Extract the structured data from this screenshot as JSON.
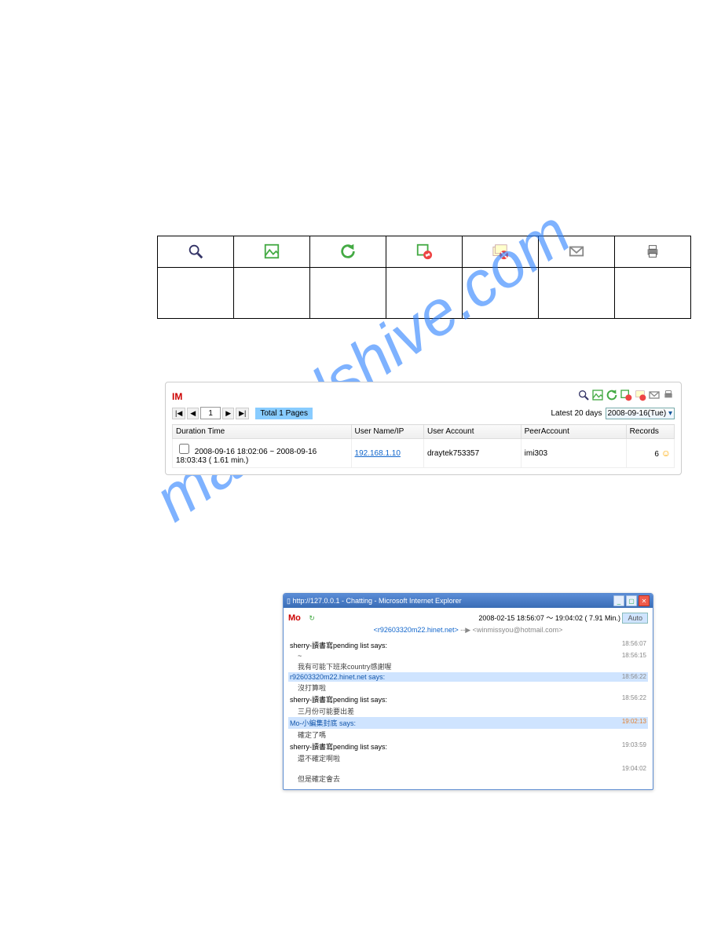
{
  "watermark": "manualshive.com",
  "toolbar_icons": {
    "search": "search-icon",
    "image": "image-icon",
    "refresh": "refresh-icon",
    "delsel": "delete-selected-icon",
    "delall": "delete-all-icon",
    "mail": "mail-icon",
    "print": "print-icon"
  },
  "toolbar_labels": {
    "search": "",
    "image": "",
    "refresh": "",
    "delsel": "",
    "delall": "",
    "mail": "",
    "print": ""
  },
  "im": {
    "title": "IM",
    "pager": {
      "first": "|◀",
      "prev": "◀",
      "page": "1",
      "next": "▶",
      "last": "▶|",
      "total": "Total 1 Pages"
    },
    "latest_label": "Latest 20 days",
    "latest_value": "2008-09-16(Tue)",
    "columns": {
      "duration": "Duration Time",
      "username": "User Name/IP",
      "useraccount": "User Account",
      "peeraccount": "PeerAccount",
      "records": "Records"
    },
    "row": {
      "duration": "2008-09-16 18:02:06 ~ 2008-09-16 18:03:43 ( 1.61 min.)",
      "ip": "192.168.1.10",
      "useraccount": "draytek753357",
      "peeraccount": "imi303",
      "records": "6"
    }
  },
  "chat": {
    "title": "http://127.0.0.1 - Chatting - Microsoft Internet Explorer",
    "mo": "Mo",
    "time_range": "2008-02-15 18:56:07 ～ 19:04:02 ( 7.91 Min.)",
    "auto": "Auto",
    "addr1": "<r92603320m22.hinet.net>",
    "addr_sep": "--▶",
    "addr2": "<winmissyou@hotmail.com>",
    "messages": [
      {
        "who": "sherry-讀書寫pending list says:",
        "time": "18:56:07",
        "hl": false
      },
      {
        "who": "~",
        "time": "18:56:15",
        "hl": false,
        "indent": true
      },
      {
        "who": "我有可能下班來country感謝喔",
        "time": "",
        "hl": false,
        "indent": true
      },
      {
        "who": "r92603320m22.hinet.net says:",
        "time": "18:56:22",
        "hl": true
      },
      {
        "who": "沒打算啦",
        "time": "",
        "hl": false,
        "indent": true
      },
      {
        "who": "sherry-讀書寫pending list says:",
        "time": "18:56:22",
        "hl": false
      },
      {
        "who": "三月份可能要出差",
        "time": "",
        "hl": false,
        "indent": true
      },
      {
        "who": "Mo-小編集封底 says:",
        "time": "19:02:13",
        "hl": true,
        "orange": true
      },
      {
        "who": "確定了嗎",
        "time": "",
        "hl": false,
        "indent": true
      },
      {
        "who": "sherry-讀書寫pending list says:",
        "time": "19:03:59",
        "hl": false
      },
      {
        "who": "還不確定啊啦",
        "time": "",
        "hl": false,
        "indent": true
      },
      {
        "who": "",
        "time": "19:04:02",
        "hl": false
      },
      {
        "who": "但是確定會去",
        "time": "",
        "hl": false,
        "indent": true
      }
    ]
  }
}
